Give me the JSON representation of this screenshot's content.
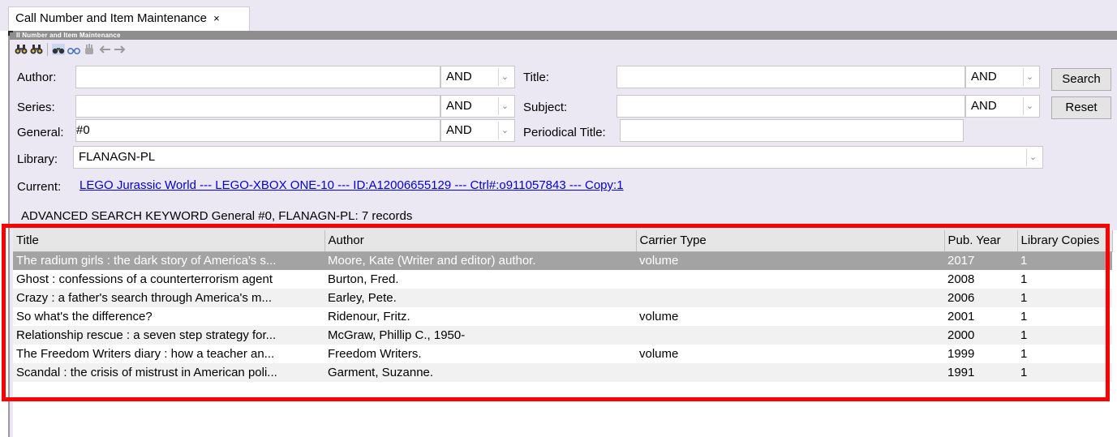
{
  "tab": {
    "label": "Call Number and Item Maintenance",
    "close": "×"
  },
  "titlebar": {
    "text": "ll Number and Item Maintenance"
  },
  "toolbar": {
    "icons": [
      "binoculars-icon",
      "binoculars-icon",
      "binoculars-icon",
      "binoculars-icon",
      "hand-icon",
      "arrow-left-icon",
      "arrow-right-icon"
    ]
  },
  "form": {
    "author_label": "Author:",
    "author_value": "",
    "author_op": "AND",
    "title_label": "Title:",
    "title_value": "",
    "title_op": "AND",
    "series_label": "Series:",
    "series_value": "",
    "series_op": "AND",
    "subject_label": "Subject:",
    "subject_value": "",
    "subject_op": "AND",
    "general_label": "General:",
    "general_value": "#0",
    "general_op": "AND",
    "periodical_label": "Periodical Title:",
    "periodical_value": "",
    "library_label": "Library:",
    "library_value": "FLANAGN-PL",
    "search_button": "Search",
    "reset_button": "Reset"
  },
  "current": {
    "label": "Current:",
    "value": "LEGO Jurassic World --- LEGO-XBOX ONE-10 --- ID:A12006655129 --- Ctrl#:o911057843 --- Copy:1"
  },
  "status": "ADVANCED SEARCH KEYWORD General #0, FLANAGN-PL: 7 records",
  "results": {
    "columns": [
      "Title",
      "Author",
      "Carrier Type",
      "Pub. Year",
      "Library Copies"
    ],
    "rows": [
      {
        "title": "The radium girls : the dark story of America's s...",
        "author": "Moore, Kate (Writer and editor) author.",
        "carrier": "volume",
        "year": "2017",
        "copies": "1"
      },
      {
        "title": "Ghost : confessions of a counterterrorism agent",
        "author": "Burton, Fred.",
        "carrier": "",
        "year": "2008",
        "copies": "1"
      },
      {
        "title": "Crazy : a father's search through America's m...",
        "author": "Earley, Pete.",
        "carrier": "",
        "year": "2006",
        "copies": "1"
      },
      {
        "title": "So what's the difference?",
        "author": "Ridenour, Fritz.",
        "carrier": "volume",
        "year": "2001",
        "copies": "1"
      },
      {
        "title": "Relationship rescue : a seven step strategy for...",
        "author": "McGraw, Phillip C., 1950-",
        "carrier": "",
        "year": "2000",
        "copies": "1"
      },
      {
        "title": "The Freedom Writers diary : how a teacher an...",
        "author": "Freedom Writers.",
        "carrier": "volume",
        "year": "1999",
        "copies": "1"
      },
      {
        "title": "Scandal : the crisis of mistrust in American poli...",
        "author": "Garment, Suzanne.",
        "carrier": "",
        "year": "1991",
        "copies": "1"
      }
    ]
  },
  "highlight_color": "#ff0000",
  "selection_color": "#a3a3a3"
}
